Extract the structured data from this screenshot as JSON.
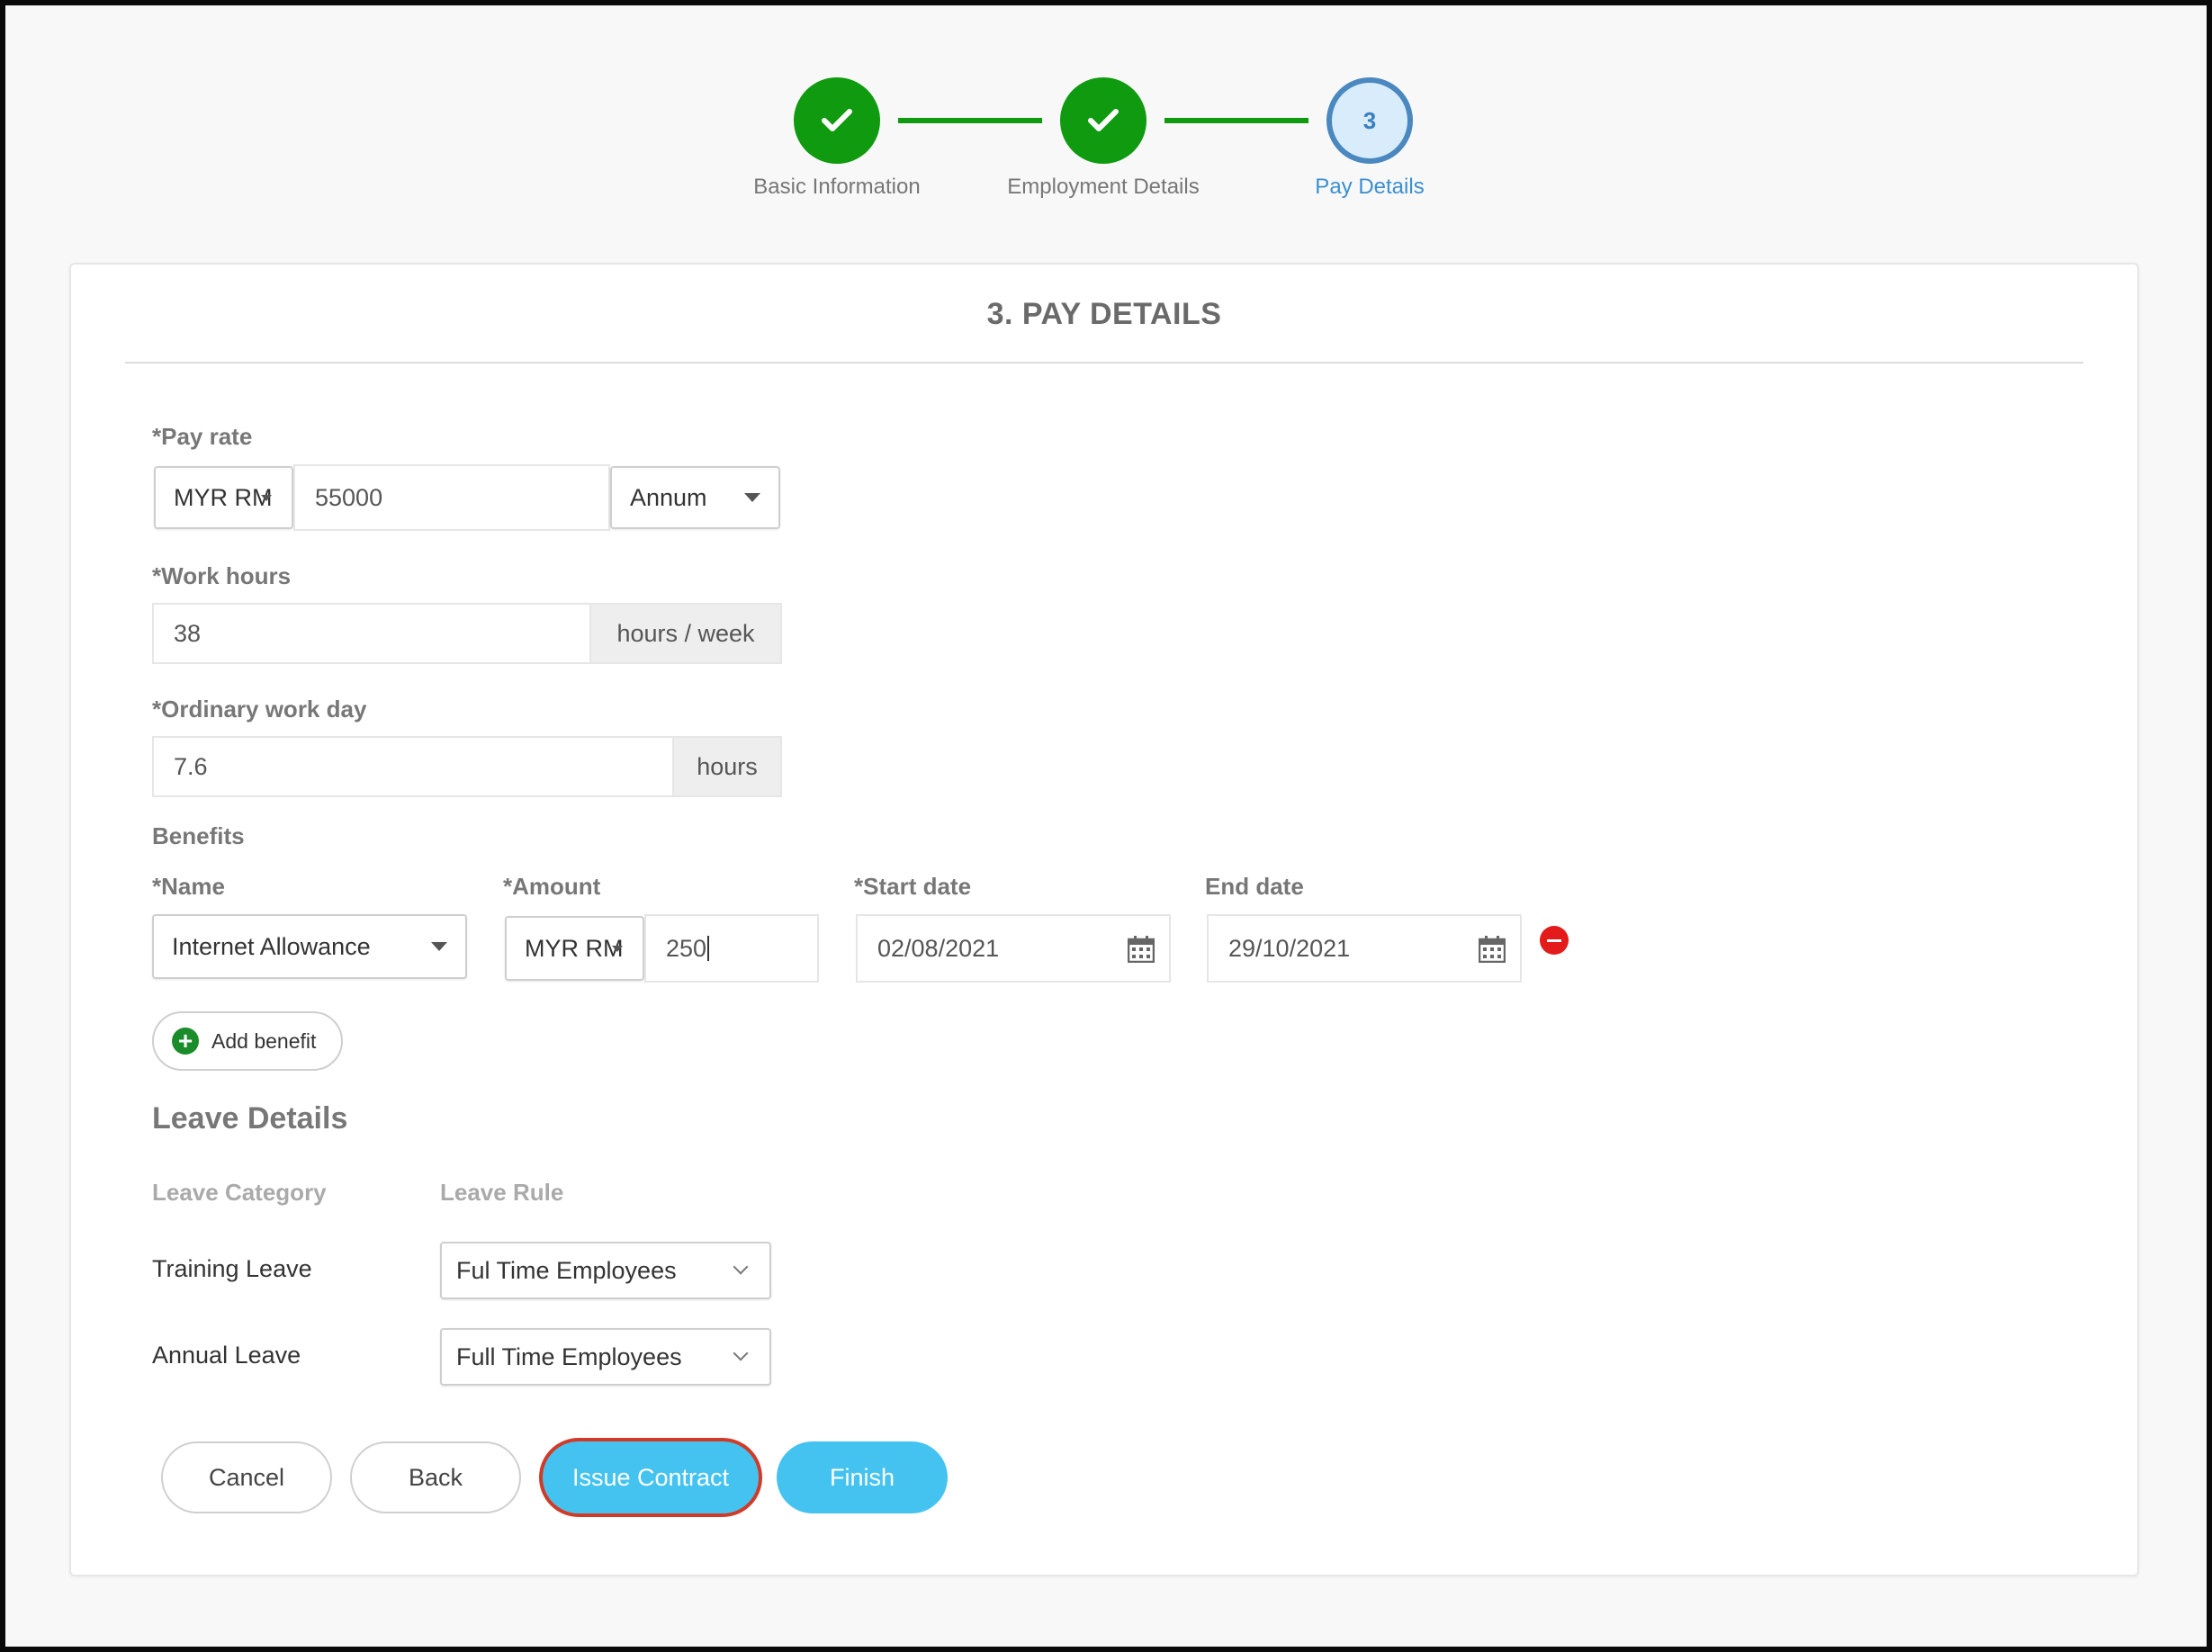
{
  "stepper": {
    "steps": [
      {
        "label": "Basic Information",
        "state": "done"
      },
      {
        "label": "Employment Details",
        "state": "done"
      },
      {
        "label": "Pay Details",
        "state": "active",
        "number": "3"
      }
    ]
  },
  "form": {
    "title": "3. PAY DETAILS",
    "pay_rate": {
      "label": "*Pay rate",
      "currency": "MYR RM",
      "value": "55000",
      "period": "Annum"
    },
    "work_hours": {
      "label": "*Work hours",
      "value": "38",
      "unit": "hours / week"
    },
    "ordinary_work_day": {
      "label": "*Ordinary work day",
      "value": "7.6",
      "unit": "hours"
    },
    "benefits": {
      "section_label": "Benefits",
      "name_label": "*Name",
      "amount_label": "*Amount",
      "start_label": "*Start date",
      "end_label": "End date",
      "row": {
        "name": "Internet Allowance",
        "currency": "MYR RM",
        "amount": "250",
        "start_date": "02/08/2021",
        "end_date": "29/10/2021"
      },
      "add_label": "Add benefit"
    },
    "leave": {
      "title": "Leave Details",
      "category_header": "Leave Category",
      "rule_header": "Leave Rule",
      "rows": [
        {
          "category": "Training Leave",
          "rule": "Ful Time Employees"
        },
        {
          "category": "Annual Leave",
          "rule": "Full Time Employees"
        }
      ]
    },
    "actions": {
      "cancel": "Cancel",
      "back": "Back",
      "issue_contract": "Issue Contract",
      "finish": "Finish"
    }
  },
  "colors": {
    "step_done": "#0f9a0f",
    "step_active": "#4a88bf",
    "primary_button": "#45c3f0",
    "highlight_outline": "#d23a28",
    "remove": "#e31b1b"
  }
}
